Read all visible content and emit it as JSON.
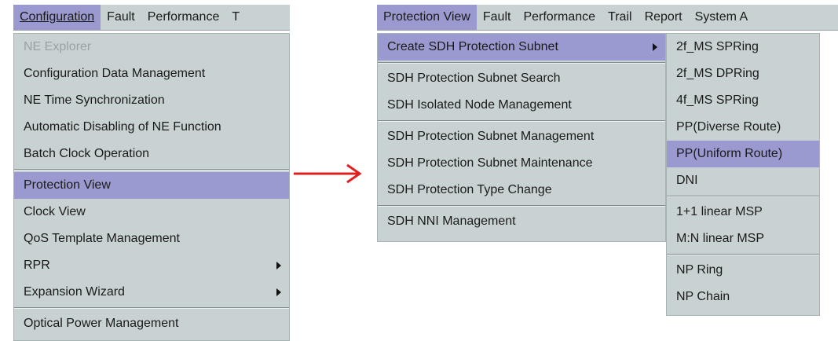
{
  "left_menu": {
    "menubar": [
      "Configuration",
      "Fault",
      "Performance",
      "T"
    ],
    "items": [
      "NE Explorer",
      "Configuration Data Management",
      "NE Time Synchronization",
      "Automatic Disabling of NE Function",
      "Batch Clock Operation",
      "Protection View",
      "Clock View",
      "QoS Template Management",
      "RPR",
      "Expansion Wizard",
      "Optical Power Management"
    ]
  },
  "right_menu": {
    "menubar": [
      "Protection View",
      "Fault",
      "Performance",
      "Trail",
      "Report",
      "System A"
    ],
    "items": [
      "Create SDH Protection Subnet",
      "SDH Protection Subnet Search",
      "SDH Isolated Node Management",
      "SDH Protection Subnet Management",
      "SDH Protection Subnet Maintenance",
      "SDH Protection Type Change",
      "SDH NNI Management"
    ]
  },
  "submenu": {
    "items": [
      "2f_MS SPRing",
      "2f_MS DPRing",
      "4f_MS SPRing",
      "PP(Diverse Route)",
      "PP(Uniform Route)",
      "DNI",
      "1+1 linear MSP",
      "M:N linear MSP",
      "NP Ring",
      "NP Chain"
    ]
  },
  "colors": {
    "menu_bg": "#c8d2d2",
    "highlight": "#9a9ad0",
    "arrow": "#e02020"
  },
  "icons": [
    "submenu-arrow-icon",
    "transition-arrow-icon"
  ]
}
